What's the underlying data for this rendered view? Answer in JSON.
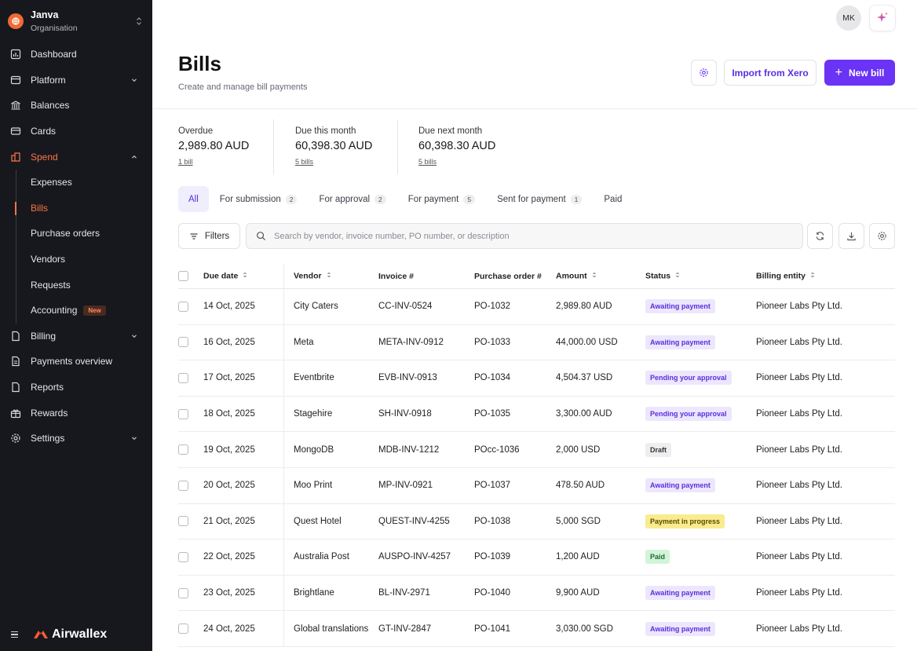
{
  "org": {
    "name": "Janva",
    "subtitle": "Organisation"
  },
  "nav": {
    "dashboard": "Dashboard",
    "platform": "Platform",
    "balances": "Balances",
    "cards": "Cards",
    "spend": "Spend",
    "spend_items": {
      "expenses": "Expenses",
      "bills": "Bills",
      "purchase_orders": "Purchase orders",
      "vendors": "Vendors",
      "requests": "Requests",
      "accounting": "Accounting",
      "accounting_badge": "New"
    },
    "billing": "Billing",
    "payments_overview": "Payments overview",
    "reports": "Reports",
    "rewards": "Rewards",
    "settings": "Settings"
  },
  "brand": "Airwallex",
  "user": {
    "initials": "MK"
  },
  "header": {
    "title": "Bills",
    "subtitle": "Create and manage bill payments",
    "import_label": "Import from Xero",
    "new_label": "New bill",
    "new_plus": "+"
  },
  "summary": {
    "overdue": {
      "label": "Overdue",
      "value": "2,989.80 AUD",
      "link": "1 bill"
    },
    "due_this_month": {
      "label": "Due this month",
      "value": "60,398.30 AUD",
      "link": "5 bills"
    },
    "due_next_month": {
      "label": "Due next month",
      "value": "60,398.30 AUD",
      "link": "5 bills"
    }
  },
  "tabs": [
    {
      "label": "All",
      "count": ""
    },
    {
      "label": "For submission",
      "count": "2"
    },
    {
      "label": "For approval",
      "count": "2"
    },
    {
      "label": "For payment",
      "count": "5"
    },
    {
      "label": "Sent for payment",
      "count": "1"
    },
    {
      "label": "Paid",
      "count": ""
    }
  ],
  "filters_label": "Filters",
  "search": {
    "placeholder": "Search by vendor, invoice number, PO number, or description",
    "value": ""
  },
  "columns": {
    "due_date": "Due date",
    "vendor": "Vendor",
    "invoice": "Invoice #",
    "po": "Purchase order #",
    "amount": "Amount",
    "status": "Status",
    "entity": "Billing entity"
  },
  "rows": [
    {
      "date": "14 Oct, 2025",
      "vendor": "City Caters",
      "invoice": "CC-INV-0524",
      "po": "PO-1032",
      "amount": "2,989.80 AUD",
      "status": "Awaiting payment",
      "entity": "Pioneer Labs Pty Ltd."
    },
    {
      "date": "16 Oct, 2025",
      "vendor": "Meta",
      "invoice": "META-INV-0912",
      "po": "PO-1033",
      "amount": "44,000.00 USD",
      "status": "Awaiting payment",
      "entity": "Pioneer Labs Pty Ltd."
    },
    {
      "date": "17 Oct, 2025",
      "vendor": "Eventbrite",
      "invoice": "EVB-INV-0913",
      "po": "PO-1034",
      "amount": "4,504.37 USD",
      "status": "Pending your approval",
      "entity": "Pioneer Labs Pty Ltd."
    },
    {
      "date": "18 Oct, 2025",
      "vendor": "Stagehire",
      "invoice": "SH-INV-0918",
      "po": "PO-1035",
      "amount": "3,300.00 AUD",
      "status": "Pending your approval",
      "entity": "Pioneer Labs Pty Ltd."
    },
    {
      "date": "19 Oct, 2025",
      "vendor": "MongoDB",
      "invoice": "MDB-INV-1212",
      "po": "POcc-1036",
      "amount": "2,000 USD",
      "status": "Draft",
      "entity": "Pioneer Labs Pty Ltd."
    },
    {
      "date": "20 Oct, 2025",
      "vendor": "Moo Print",
      "invoice": "MP-INV-0921",
      "po": "PO-1037",
      "amount": "478.50 AUD",
      "status": "Awaiting payment",
      "entity": "Pioneer Labs Pty Ltd."
    },
    {
      "date": "21 Oct, 2025",
      "vendor": "Quest Hotel",
      "invoice": "QUEST-INV-4255",
      "po": "PO-1038",
      "amount": "5,000 SGD",
      "status": "Payment in progress",
      "entity": "Pioneer Labs Pty Ltd."
    },
    {
      "date": "22 Oct, 2025",
      "vendor": "Australia Post",
      "invoice": "AUSPO-INV-4257",
      "po": "PO-1039",
      "amount": "1,200 AUD",
      "status": "Paid",
      "entity": "Pioneer Labs Pty Ltd."
    },
    {
      "date": "23 Oct, 2025",
      "vendor": "Brightlane",
      "invoice": "BL-INV-2971",
      "po": "PO-1040",
      "amount": "9,900 AUD",
      "status": "Awaiting payment",
      "entity": "Pioneer Labs Pty Ltd."
    },
    {
      "date": "24 Oct, 2025",
      "vendor": "Global translations",
      "invoice": "GT-INV-2847",
      "po": "PO-1041",
      "amount": "3,030.00 SGD",
      "status": "Awaiting payment",
      "entity": "Pioneer Labs Pty Ltd."
    }
  ],
  "colors": {
    "sidebar_bg": "#16181d",
    "accent": "#6a33f5",
    "active_nav": "#ff7448",
    "brand_orange": "#f06a35"
  }
}
